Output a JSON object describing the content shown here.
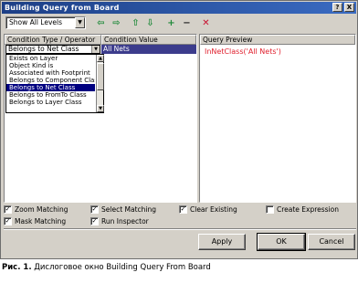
{
  "window": {
    "title": "Building Query from Board",
    "help_label": "?",
    "close_label": "X"
  },
  "toolbar": {
    "level_select": "Show All Levels",
    "tools": [
      {
        "icon": "arrow-left-icon",
        "glyph": "⇦"
      },
      {
        "icon": "arrow-right-icon",
        "glyph": "⇨"
      },
      {
        "icon": "arrow-up-icon",
        "glyph": "⇧"
      },
      {
        "icon": "arrow-down-icon",
        "glyph": "⇩"
      },
      {
        "icon": "add-icon",
        "glyph": "+"
      },
      {
        "icon": "remove-icon",
        "glyph": "−"
      },
      {
        "icon": "delete-icon",
        "glyph": "✕"
      }
    ]
  },
  "conditions": {
    "header_type": "Condition Type / Operator",
    "header_value": "Condition Value",
    "current_type": "Belongs to Net Class",
    "current_value": "All Nets",
    "dropdown_items": [
      "Exists on Layer",
      "Object Kind is",
      "Associated with Footprint",
      "Belongs to Component Class",
      "Belongs to Net Class",
      "Belongs to FromTo Class",
      "Belongs to Layer Class"
    ],
    "selected_index": 4
  },
  "preview": {
    "header": "Query Preview",
    "query": "InNetClass('All Nets')",
    "query_color": "#e0202e"
  },
  "options": {
    "zoom_matching": {
      "label": "Zoom Matching",
      "checked": true
    },
    "select_matching": {
      "label": "Select Matching",
      "checked": true
    },
    "clear_existing": {
      "label": "Clear Existing",
      "checked": true
    },
    "create_expression": {
      "label": "Create Expression",
      "checked": false
    },
    "mask_matching": {
      "label": "Mask Matching",
      "checked": true
    },
    "run_inspector": {
      "label": "Run Inspector",
      "checked": true
    }
  },
  "buttons": {
    "apply": "Apply",
    "ok": "OK",
    "cancel": "Cancel"
  },
  "caption": {
    "prefix": "Рис. 1.",
    "text": "Дислоговое окно Building Query From Board"
  }
}
